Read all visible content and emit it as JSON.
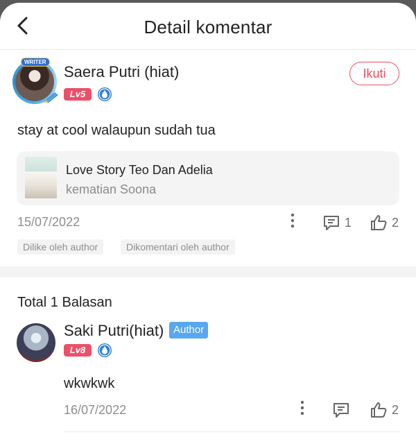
{
  "header": {
    "title": "Detail komentar"
  },
  "comment": {
    "author": "Saera Putri (hiat)",
    "avatar_tag": "WRITER",
    "level": "Lv5",
    "follow_label": "Ikuti",
    "text": "stay at cool walaupun sudah tua",
    "story": {
      "title": "Love Story Teo Dan Adelia",
      "subtitle": "kematian Soona"
    },
    "date": "15/07/2022",
    "reply_count": "1",
    "like_count": "2",
    "tags": [
      "Dilike oleh author",
      "Dikomentari oleh author"
    ]
  },
  "replies": {
    "total_label": "Total 1 Balasan",
    "items": [
      {
        "author": "Saki Putri(hiat)",
        "badge": "Author",
        "level": "Lv8",
        "text": "wkwkwk",
        "date": "16/07/2022",
        "like_count": "2"
      }
    ]
  },
  "colors": {
    "accent": "#ea4e66",
    "level_badge": "#ee4f68",
    "author_badge": "#58a7f0",
    "sapphire": "#2f7fd8"
  },
  "icons": [
    "back-arrow-icon",
    "pen-icon",
    "sapphire-drop-icon",
    "more-vertical-icon",
    "comment-icon",
    "thumbs-up-icon"
  ]
}
